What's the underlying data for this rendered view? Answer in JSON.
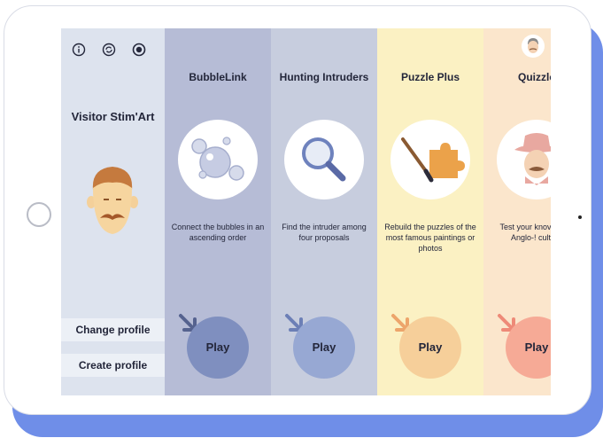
{
  "sidebar": {
    "icons": [
      "info-icon",
      "refresh-icon",
      "settings-icon"
    ],
    "visitor_name": "Visitor Stim'Art",
    "change_profile": "Change profile",
    "create_profile": "Create profile"
  },
  "games": [
    {
      "title": "BubbleLink",
      "description": "Connect the bubbles in an ascending order",
      "play": "Play",
      "bg": "#b6bcd6",
      "play_color": "#7f8fbf",
      "arrow_color": "#55628f"
    },
    {
      "title": "Hunting Intruders",
      "description": "Find the intruder among four proposals",
      "play": "Play",
      "bg": "#c7cdde",
      "play_color": "#97a8d3",
      "arrow_color": "#6c7fb6"
    },
    {
      "title": "Puzzle Plus",
      "description": "Rebuild the puzzles of the most famous paintings or photos",
      "play": "Play",
      "bg": "#fbf1c3",
      "play_color": "#f6cf9a",
      "arrow_color": "#eda56b"
    },
    {
      "title": "Quizzle",
      "description": "Test your knov of the Anglo-! culture",
      "play": "Play",
      "bg": "#fbe6cc",
      "play_color": "#f6aa96",
      "arrow_color": "#ee8a78"
    }
  ]
}
